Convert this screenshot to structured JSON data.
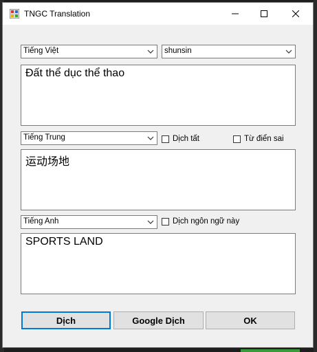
{
  "window": {
    "title": "TNGC Translation"
  },
  "source": {
    "language": "Tiếng Việt",
    "dictionary": "shunsin",
    "text": "Đất thể dục thể thao"
  },
  "target1": {
    "language": "Tiếng Trung",
    "translate_all_label": "Dịch tất",
    "wrong_dictionary_label": "Từ điển sai",
    "text": "运动场地"
  },
  "target2": {
    "language": "Tiếng Anh",
    "translate_this_label": "Dịch ngôn ngữ này",
    "text": "SPORTS LAND"
  },
  "buttons": {
    "translate": "Dịch",
    "google_translate": "Google Dịch",
    "ok": "OK"
  }
}
